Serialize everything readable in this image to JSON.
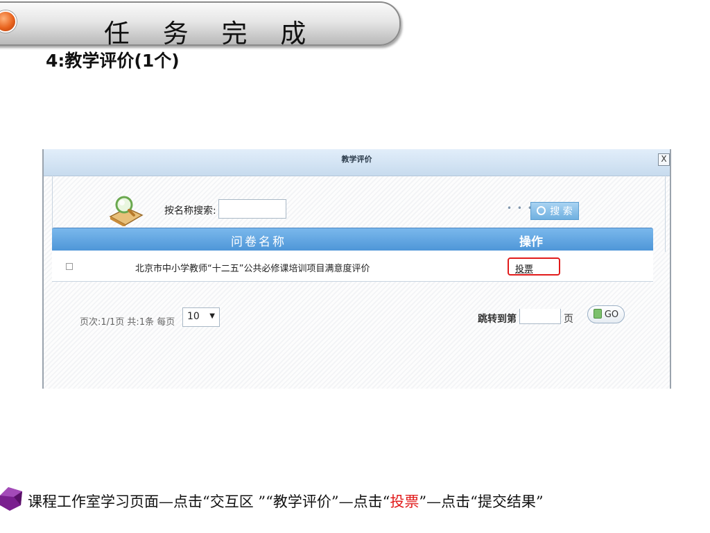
{
  "slide": {
    "title": "任 务 完 成",
    "subtitle": "4:教学评价(1个)"
  },
  "dialog": {
    "title": "教学评价",
    "close_label": "X",
    "search_label": "按名称搜索:",
    "search_value": "",
    "search_dots": "• • •",
    "search_button": "搜 索",
    "table": {
      "headers": [
        "问卷名称",
        "操作"
      ],
      "rows": [
        {
          "name": "北京市中小学教师“十二五”公共必修课培训项目满意度评价",
          "action": "投票"
        }
      ]
    },
    "pager": {
      "info": "页次:1/1页  共:1条 每页",
      "page_size": "10",
      "caret": "▼",
      "jump_label": "跳转到第",
      "jump_suffix": "页",
      "go_label": "GO"
    }
  },
  "caption": {
    "part1": "课程工作室学习页面—点击“交互区 ”“教学评价”—点击“",
    "highlight": "投票",
    "part2": "”—点击“提交结果”"
  },
  "colors": {
    "highlight_red": "#e11b1b",
    "table_header_blue": "#5a9fdc",
    "title_accent_orange": "#e8631e",
    "bullet_purple": "#7a1f8f"
  }
}
